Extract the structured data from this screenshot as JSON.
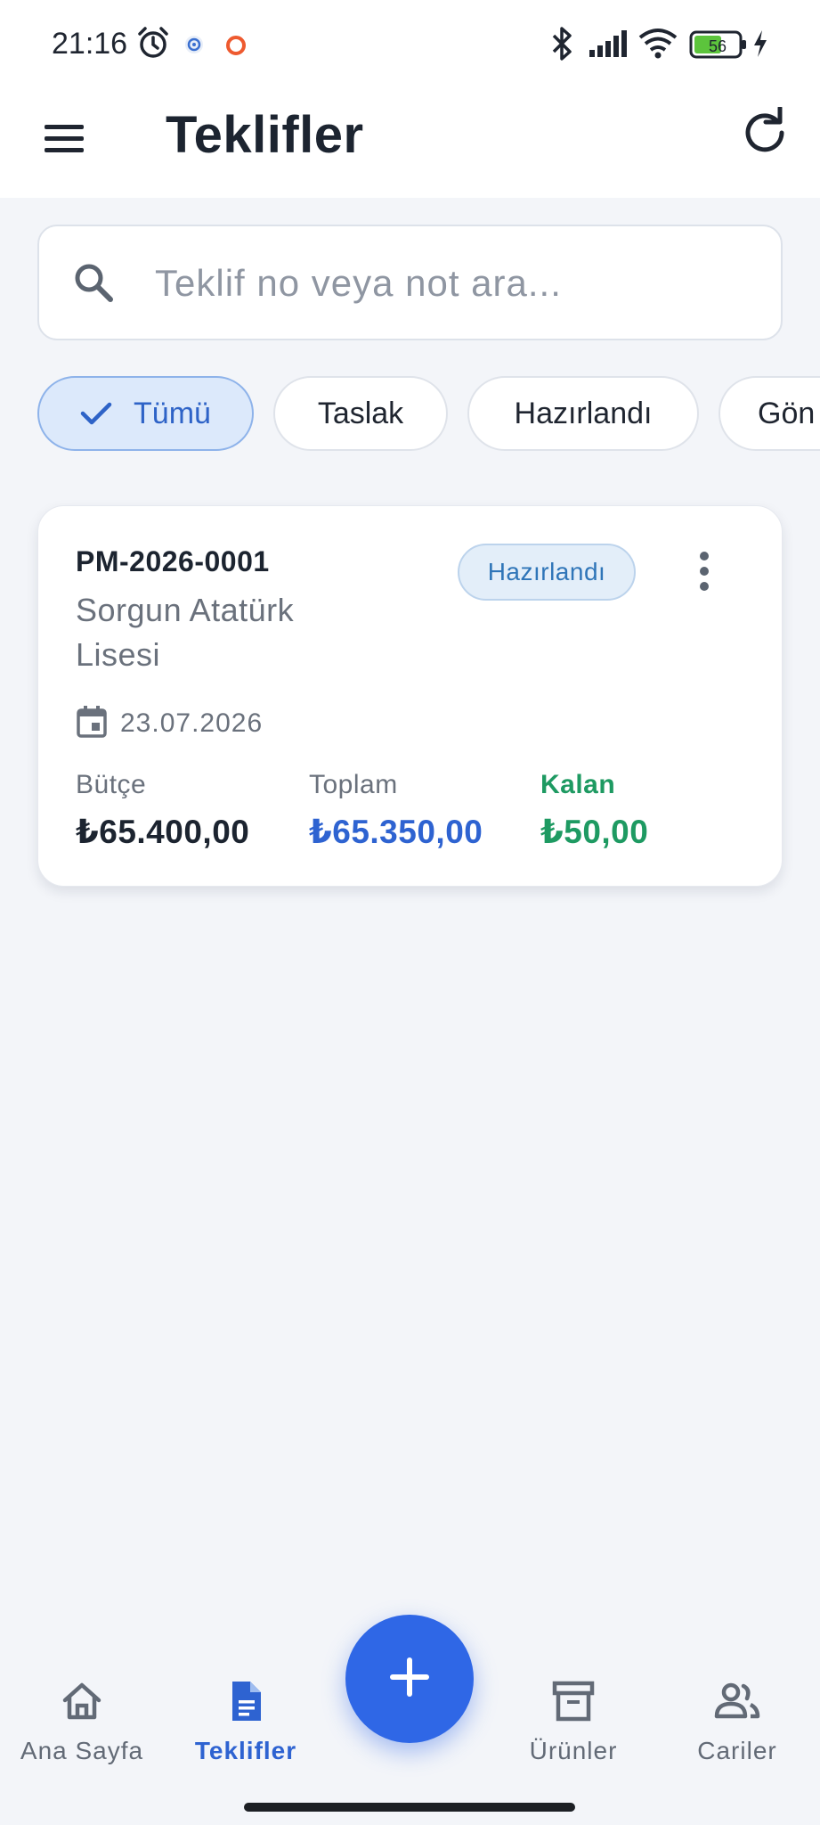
{
  "status_bar": {
    "time": "21:16",
    "battery": "56",
    "icons": [
      "alarm-icon",
      "app-notification-icon",
      "app-notification-icon",
      "bluetooth-icon",
      "signal-icon",
      "wifi-icon",
      "battery-icon",
      "charging-icon"
    ]
  },
  "app_bar": {
    "title": "Teklifler",
    "menu_icon": "hamburger-menu-icon",
    "refresh_icon": "refresh-icon"
  },
  "search": {
    "placeholder": "Teklif no veya not ara...",
    "value": ""
  },
  "filters": [
    {
      "label": "Tümü",
      "selected": true
    },
    {
      "label": "Taslak",
      "selected": false
    },
    {
      "label": "Hazırlandı",
      "selected": false
    },
    {
      "label": "Gön",
      "selected": false
    }
  ],
  "quotes": [
    {
      "number": "PM-2026-0001",
      "customer": "Sorgun Atatürk Lisesi",
      "status": "Hazırlandı",
      "date": "23.07.2026",
      "budget_label": "Bütçe",
      "budget": "₺65.400,00",
      "total_label": "Toplam",
      "total": "₺65.350,00",
      "remaining_label": "Kalan",
      "remaining": "₺50,00"
    }
  ],
  "bottom_nav": [
    {
      "label": "Ana Sayfa",
      "icon": "home-icon",
      "active": false
    },
    {
      "label": "Teklifler",
      "icon": "document-icon",
      "active": true
    },
    {
      "label": "Ürünler",
      "icon": "archive-icon",
      "active": false
    },
    {
      "label": "Cariler",
      "icon": "people-icon",
      "active": false
    }
  ],
  "colors": {
    "accent": "#2f67e6",
    "background": "#f3f5f9",
    "status_badge": "#2f75b8",
    "remaining": "#1e9a62"
  }
}
